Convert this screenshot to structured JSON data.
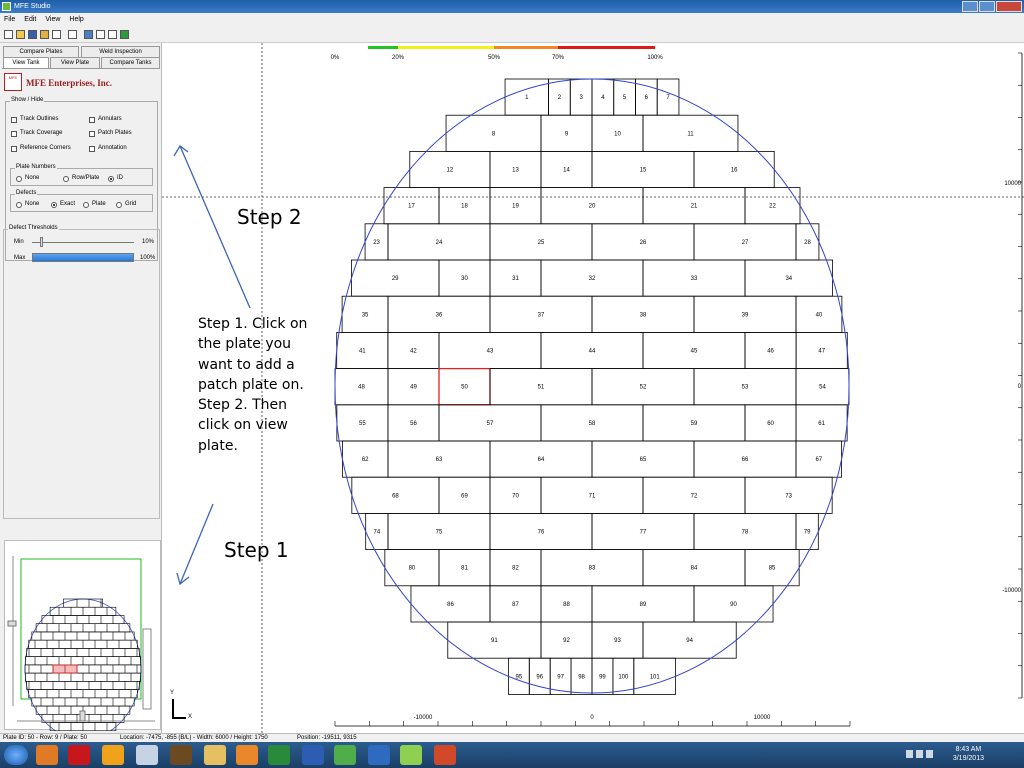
{
  "window": {
    "title": "MFE Studio"
  },
  "menu": [
    "File",
    "Edit",
    "View",
    "Help"
  ],
  "tabs": {
    "row1": [
      "Compare Plates",
      "Weld Inspection"
    ],
    "row2": [
      "View Tank",
      "View Plate",
      "Compare Tanks"
    ]
  },
  "brand": {
    "name": "MFE Enterprises, Inc.",
    "logo_text": "MFE"
  },
  "show_hide": {
    "title": "Show / Hide",
    "left": [
      "Track Outlines",
      "Track Coverage",
      "Reference Corners"
    ],
    "right": [
      "Annulars",
      "Patch Plates",
      "Annotation"
    ]
  },
  "plate_numbers": {
    "title": "Plate Numbers",
    "options": [
      "None",
      "Row/Plate",
      "ID"
    ],
    "selected": 2
  },
  "defects": {
    "title": "Defects",
    "options": [
      "None",
      "Exact",
      "Plate",
      "Grid"
    ],
    "selected": 1
  },
  "thresholds": {
    "title": "Defect Thresholds",
    "min_label": "Min",
    "min_value": "10%",
    "min_fraction": 0.1,
    "max_label": "Max",
    "max_value": "100%",
    "max_fraction": 1.0
  },
  "color_scale": {
    "labels": [
      "0%",
      "20%",
      "50%",
      "70%",
      "100%"
    ],
    "colors": [
      "#22c422",
      "#f2f21a",
      "#f0882a",
      "#e01818"
    ]
  },
  "axis": {
    "x_labels": [
      "-10000",
      "0",
      "10000"
    ],
    "y_labels": [
      "10000",
      "0",
      "-10000"
    ],
    "corner_y": "Y",
    "corner_x": "X"
  },
  "plates": {
    "selected_id": 50,
    "rows": [
      [
        "1",
        "2",
        "3",
        "4",
        "5",
        "6",
        "7"
      ],
      [
        "8",
        "9",
        "10",
        "11"
      ],
      [
        "12",
        "13",
        "14",
        "15",
        "16"
      ],
      [
        "17",
        "18",
        "19",
        "20",
        "21",
        "22"
      ],
      [
        "23",
        "24",
        "25",
        "26",
        "27",
        "28"
      ],
      [
        "29",
        "30",
        "31",
        "32",
        "33",
        "34"
      ],
      [
        "35",
        "36",
        "37",
        "38",
        "39",
        "40"
      ],
      [
        "41",
        "42",
        "43",
        "44",
        "45",
        "46",
        "47"
      ],
      [
        "48",
        "49",
        "50",
        "51",
        "52",
        "53",
        "54"
      ],
      [
        "55",
        "56",
        "57",
        "58",
        "59",
        "60",
        "61"
      ],
      [
        "62",
        "63",
        "64",
        "65",
        "66",
        "67"
      ],
      [
        "68",
        "69",
        "70",
        "71",
        "72",
        "73"
      ],
      [
        "74",
        "75",
        "76",
        "77",
        "78",
        "79"
      ],
      [
        "80",
        "81",
        "82",
        "83",
        "84",
        "85"
      ],
      [
        "86",
        "87",
        "88",
        "89",
        "90"
      ],
      [
        "91",
        "92",
        "93",
        "94"
      ],
      [
        "95",
        "96",
        "97",
        "98",
        "99",
        "100",
        "101"
      ]
    ]
  },
  "annotations": {
    "instructions": "Step 1. Click on the plate you want to add a patch plate on. Step 2.  Then click on view plate.",
    "step2": "Step  2",
    "step1": "Step 1"
  },
  "status": {
    "plate": "Plate ID: 50 - Row: 9 / Plate: 50",
    "location": "Location: -7475, -855 (B/L) - Width: 6000 / Height: 1750",
    "position": "Position: -19511, 9315"
  },
  "clock": {
    "time": "8:43 AM",
    "date": "3/19/2013"
  }
}
